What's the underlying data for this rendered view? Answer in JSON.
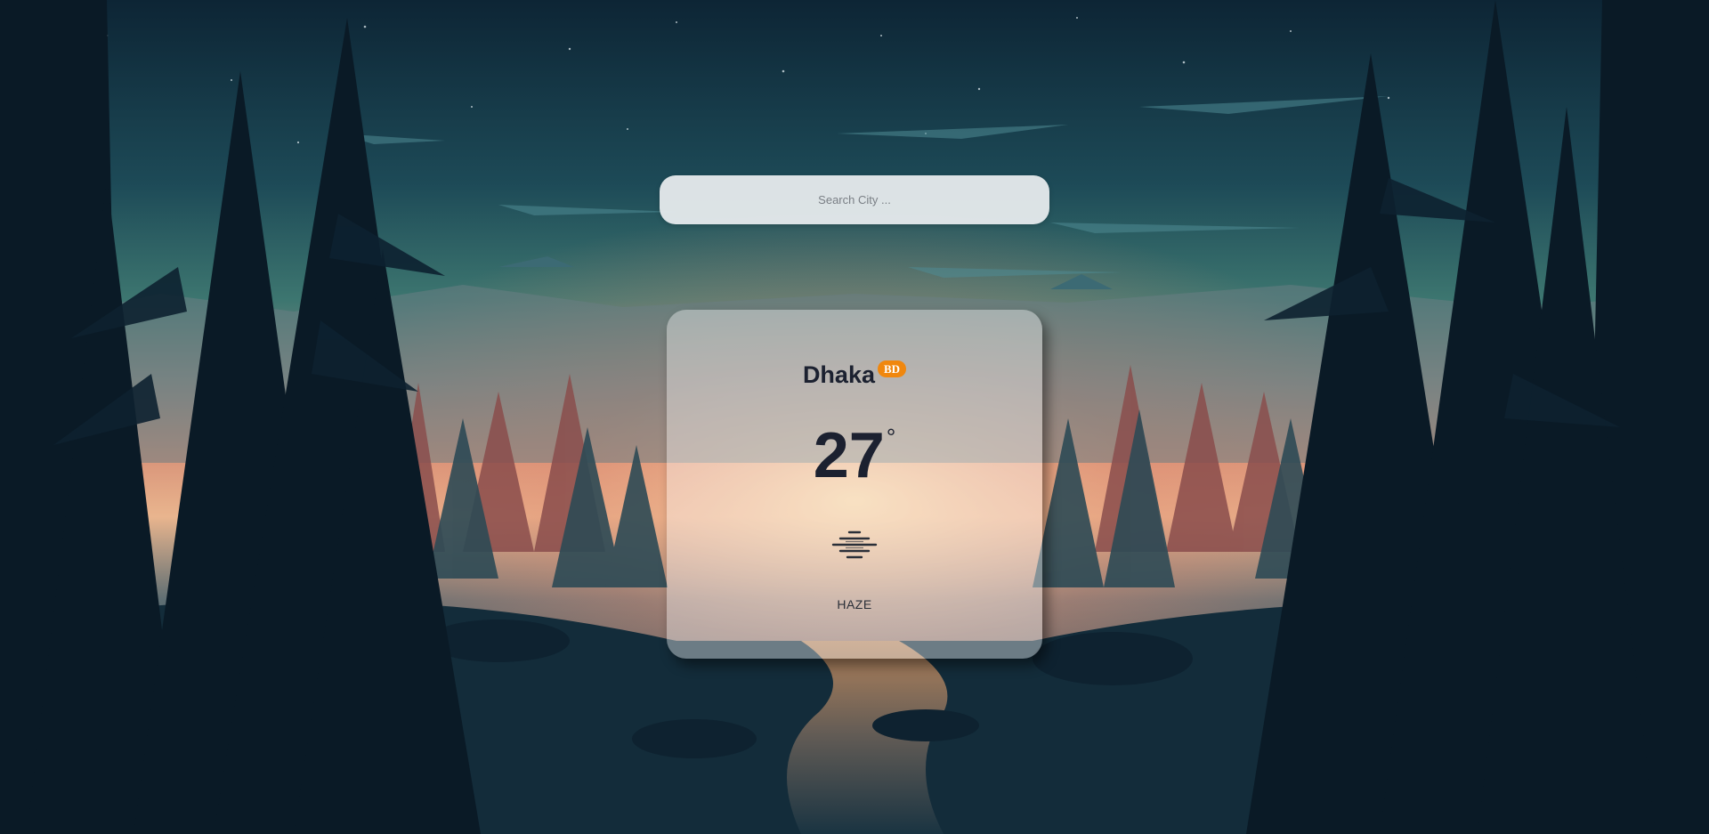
{
  "search": {
    "placeholder": "Search City ...",
    "value": ""
  },
  "weather": {
    "city": "Dhaka",
    "country_code": "BD",
    "temperature": "27",
    "unit_symbol": "°",
    "condition": "HAZE",
    "icon": "haze-icon"
  },
  "colors": {
    "badge": "#f0870e",
    "text_dark": "#1c2130",
    "sky_top": "#0f2a3a",
    "sky_mid": "#2f6b72",
    "glow": "#e8a07a"
  }
}
